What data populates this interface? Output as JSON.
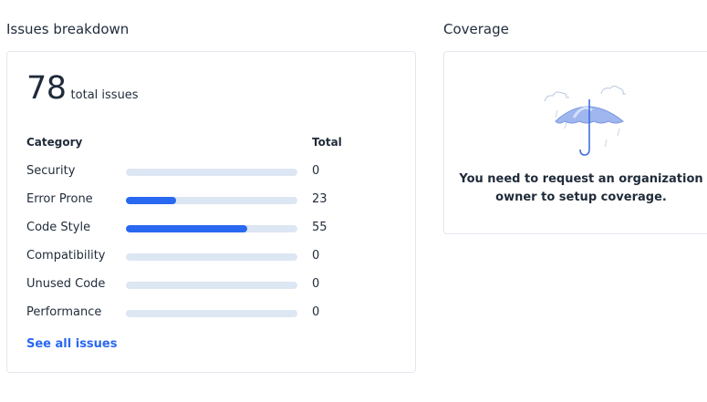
{
  "issues_section": {
    "title": "Issues breakdown",
    "total_count": "78",
    "total_label": "total issues",
    "header_category": "Category",
    "header_total": "Total",
    "categories": [
      {
        "label": "Security",
        "count": "0",
        "fraction": 0
      },
      {
        "label": "Error Prone",
        "count": "23",
        "fraction": 0.29
      },
      {
        "label": "Code Style",
        "count": "55",
        "fraction": 0.71
      },
      {
        "label": "Compatibility",
        "count": "0",
        "fraction": 0
      },
      {
        "label": "Unused Code",
        "count": "0",
        "fraction": 0
      },
      {
        "label": "Performance",
        "count": "0",
        "fraction": 0
      }
    ],
    "see_all_label": "See all issues"
  },
  "coverage_section": {
    "title": "Coverage",
    "illustration_icon": "umbrella-rain-icon",
    "message_line1": "You need to request an organization",
    "message_line2": "owner to setup coverage."
  },
  "colors": {
    "accent": "#2968f0",
    "track": "#dde6f3",
    "text": "#1f2b3a"
  }
}
